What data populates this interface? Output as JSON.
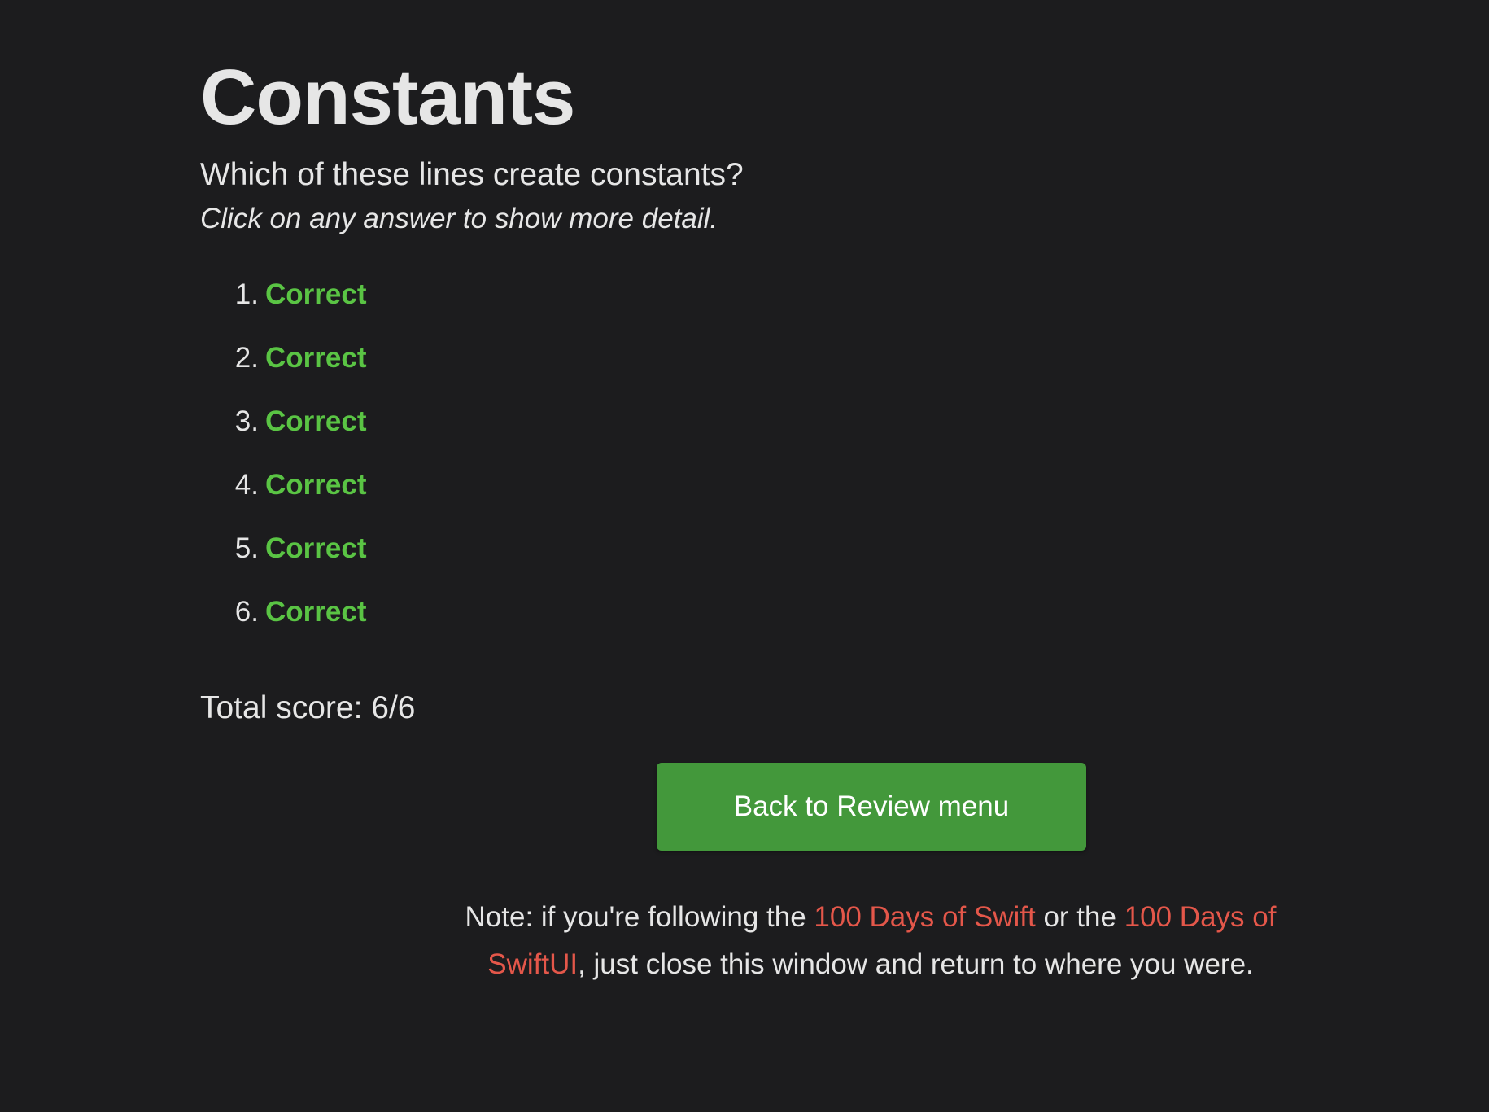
{
  "page": {
    "title": "Constants",
    "question": "Which of these lines create constants?",
    "hint": "Click on any answer to show more detail."
  },
  "answers": [
    {
      "number": "1.",
      "status": "Correct"
    },
    {
      "number": "2.",
      "status": "Correct"
    },
    {
      "number": "3.",
      "status": "Correct"
    },
    {
      "number": "4.",
      "status": "Correct"
    },
    {
      "number": "5.",
      "status": "Correct"
    },
    {
      "number": "6.",
      "status": "Correct"
    }
  ],
  "score": {
    "text": "Total score: 6/6"
  },
  "button": {
    "back_label": "Back to Review menu"
  },
  "note": {
    "part1": "Note: if you're following the ",
    "link1": "100 Days of Swift",
    "part2": " or the ",
    "link2": "100 Days of SwiftUI",
    "part3": ", just close this window and return to where you were."
  },
  "colors": {
    "background": "#1c1c1e",
    "correct": "#5ac444",
    "button": "#43983b",
    "link": "#e4574a"
  }
}
